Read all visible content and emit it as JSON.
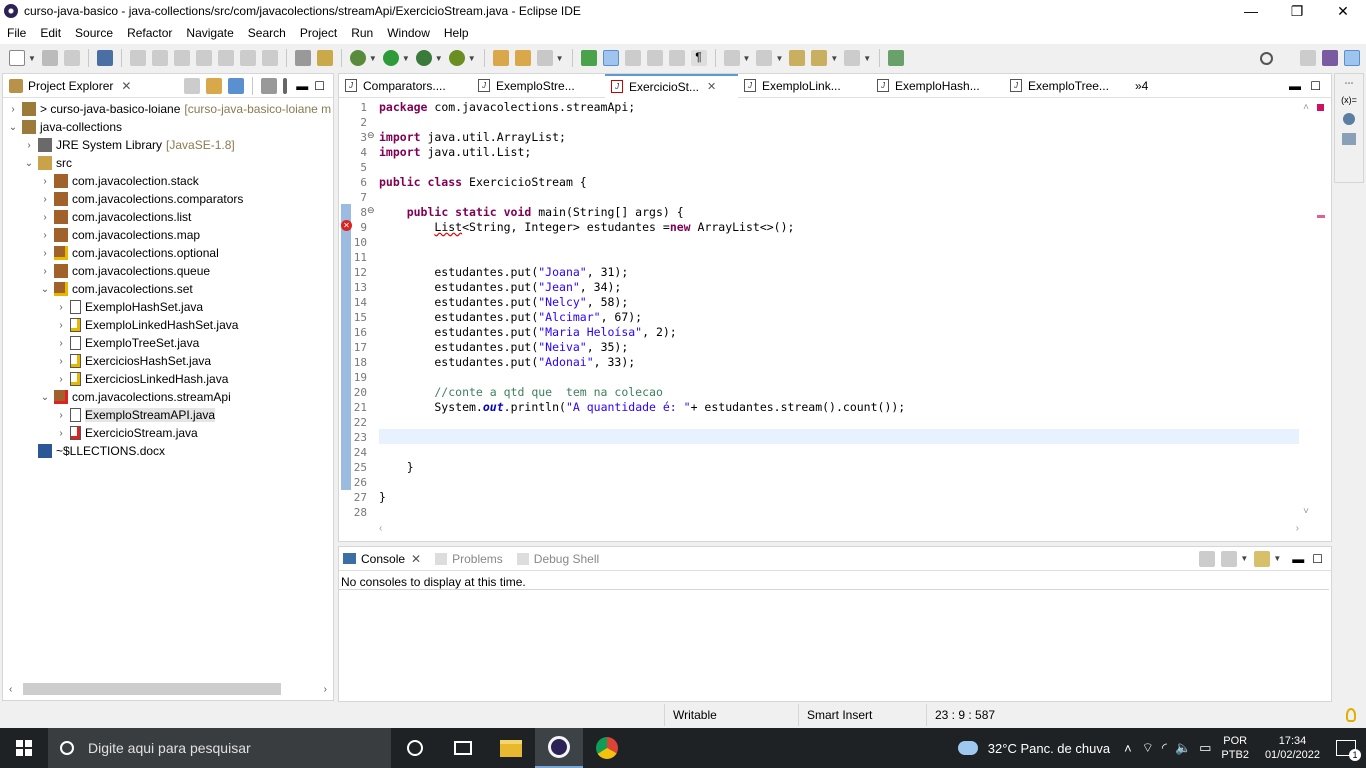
{
  "window": {
    "title": "curso-java-basico - java-collections/src/com/javacolections/streamApi/ExercicioStream.java - Eclipse IDE",
    "min": "—",
    "max": "❐",
    "close": "✕"
  },
  "menu": [
    "File",
    "Edit",
    "Source",
    "Refactor",
    "Navigate",
    "Search",
    "Project",
    "Run",
    "Window",
    "Help"
  ],
  "project_explorer": {
    "tab_label": "Project Explorer",
    "close": "✕",
    "tree": [
      {
        "label": "> curso-java-basico-loiane",
        "decor": "[curso-java-basico-loiane m",
        "indent": 0,
        "arrow": "›",
        "icon": "project-icon"
      },
      {
        "label": "java-collections",
        "decor": "",
        "indent": 0,
        "arrow": "⌄",
        "icon": "project-icon"
      },
      {
        "label": "JRE System Library",
        "decor": "[JavaSE-1.8]",
        "indent": 1,
        "arrow": "›",
        "icon": "library-icon"
      },
      {
        "label": "src",
        "decor": "",
        "indent": 1,
        "arrow": "⌄",
        "icon": "source-folder-icon"
      },
      {
        "label": "com.javacolection.stack",
        "decor": "",
        "indent": 2,
        "arrow": "›",
        "icon": "package-icon"
      },
      {
        "label": "com.javacolections.comparators",
        "decor": "",
        "indent": 2,
        "arrow": "›",
        "icon": "package-icon"
      },
      {
        "label": "com.javacolections.list",
        "decor": "",
        "indent": 2,
        "arrow": "›",
        "icon": "package-icon"
      },
      {
        "label": "com.javacolections.map",
        "decor": "",
        "indent": 2,
        "arrow": "›",
        "icon": "package-icon"
      },
      {
        "label": "com.javacolections.optional",
        "decor": "",
        "indent": 2,
        "arrow": "›",
        "icon": "package-warn-icon"
      },
      {
        "label": "com.javacolections.queue",
        "decor": "",
        "indent": 2,
        "arrow": "›",
        "icon": "package-icon"
      },
      {
        "label": "com.javacolections.set",
        "decor": "",
        "indent": 2,
        "arrow": "⌄",
        "icon": "package-warn-icon"
      },
      {
        "label": "ExemploHashSet.java",
        "decor": "",
        "indent": 3,
        "arrow": "›",
        "icon": "java-file-icon"
      },
      {
        "label": "ExemploLinkedHashSet.java",
        "decor": "",
        "indent": 3,
        "arrow": "›",
        "icon": "java-file-warn-icon"
      },
      {
        "label": "ExemploTreeSet.java",
        "decor": "",
        "indent": 3,
        "arrow": "›",
        "icon": "java-file-icon"
      },
      {
        "label": "ExerciciosHashSet.java",
        "decor": "",
        "indent": 3,
        "arrow": "›",
        "icon": "java-file-warn-icon"
      },
      {
        "label": "ExerciciosLinkedHash.java",
        "decor": "",
        "indent": 3,
        "arrow": "›",
        "icon": "java-file-warn-icon"
      },
      {
        "label": "com.javacolections.streamApi",
        "decor": "",
        "indent": 2,
        "arrow": "⌄",
        "icon": "package-error-icon"
      },
      {
        "label": "ExemploStreamAPI.java",
        "decor": "",
        "indent": 3,
        "arrow": "›",
        "icon": "java-file-icon",
        "selected": true
      },
      {
        "label": "ExercicioStream.java",
        "decor": "",
        "indent": 3,
        "arrow": "›",
        "icon": "java-file-error-icon"
      },
      {
        "label": "~$LLECTIONS.docx",
        "decor": "",
        "indent": 1,
        "arrow": "",
        "icon": "word-doc-icon"
      }
    ]
  },
  "editor": {
    "tabs": [
      {
        "label": "Comparators....",
        "active": false
      },
      {
        "label": "ExemploStre...",
        "active": false
      },
      {
        "label": "ExercicioSt...",
        "active": true
      },
      {
        "label": "ExemploLink...",
        "active": false
      },
      {
        "label": "ExemploHash...",
        "active": false
      },
      {
        "label": "ExemploTree...",
        "active": false
      }
    ],
    "overflow": "»4",
    "lines": [
      "1",
      "2",
      "3",
      "4",
      "5",
      "6",
      "7",
      "8",
      "9",
      "10",
      "11",
      "12",
      "13",
      "14",
      "15",
      "16",
      "17",
      "18",
      "19",
      "20",
      "21",
      "22",
      "23",
      "24",
      "25",
      "26",
      "27",
      "28"
    ],
    "code": {
      "l1_kw": "package",
      "l1_rest": " com.javacolections.streamApi;",
      "l3_kw": "import",
      "l3_rest": " java.util.ArrayList;",
      "l4_kw": "import",
      "l4_rest": " java.util.List;",
      "l6_kw": "public class",
      "l6_rest": " ExercicioStream {",
      "l8_indent": "    ",
      "l8_kw": "public static void",
      "l8_rest": " main(String[] args) {",
      "l9_indent": "        ",
      "l9_err": "List",
      "l9_a": "<String, Integer> estudantes =",
      "l9_kw": "new",
      "l9_b": " ArrayList<>();",
      "put_prefix": "        estudantes.put(",
      "puts": [
        {
          "name": "\"Joana\"",
          "rest": ", 31);"
        },
        {
          "name": "\"Jean\"",
          "rest": ", 34);"
        },
        {
          "name": "\"Nelcy\"",
          "rest": ", 58);"
        },
        {
          "name": "\"Alcimar\"",
          "rest": ", 67);"
        },
        {
          "name": "\"Maria Heloísa\"",
          "rest": ", 2);"
        },
        {
          "name": "\"Neiva\"",
          "rest": ", 35);"
        },
        {
          "name": "\"Adonai\"",
          "rest": ", 33);"
        }
      ],
      "l20": "        //conte a qtd que  tem na colecao",
      "l21_a": "        System.",
      "l21_fld": "out",
      "l21_b": ".println(",
      "l21_str": "\"A quantidade é: \"",
      "l21_c": "+ estudantes.stream().count());",
      "l25": "    }",
      "l27": "}"
    }
  },
  "console": {
    "tabs": [
      {
        "label": "Console",
        "active": true
      },
      {
        "label": "Problems",
        "active": false
      },
      {
        "label": "Debug Shell",
        "active": false
      }
    ],
    "message": "No consoles to display at this time."
  },
  "status": {
    "writable": "Writable",
    "insert_mode": "Smart Insert",
    "position": "23 : 9 : 587"
  },
  "taskbar": {
    "search_placeholder": "Digite aqui para pesquisar",
    "weather": "32°C  Panc. de chuva",
    "lang_top": "POR",
    "lang_bottom": "PTB2",
    "time": "17:34",
    "date": "01/02/2022",
    "notif_count": "1"
  }
}
